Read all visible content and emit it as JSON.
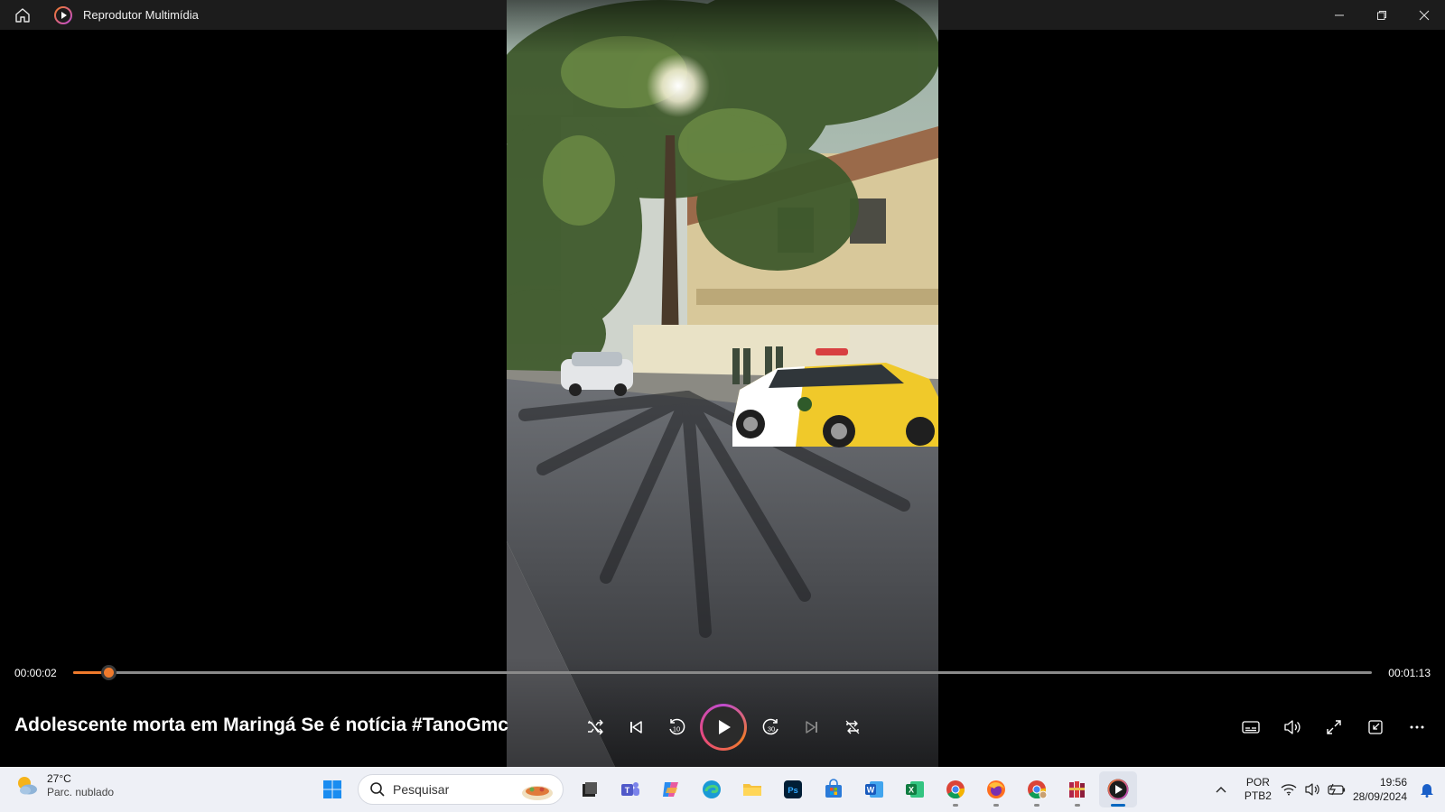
{
  "window": {
    "app_title": "Reprodutor Multimídia",
    "icons": [
      "home-icon",
      "app-logo-icon",
      "minimize-icon",
      "restore-icon",
      "close-icon"
    ]
  },
  "player": {
    "current_time": "00:00:02",
    "total_time": "00:01:13",
    "progress": 0.027,
    "media_title": "Adolescente morta em Maringá Se é notícia #TanoGmc",
    "accent_color": "#f07a2c",
    "controls": [
      "shuffle-icon",
      "previous-icon",
      "rewind-10-icon",
      "play-icon",
      "forward-30-icon",
      "next-icon",
      "repeat-off-icon"
    ],
    "skip_back_label": "10",
    "skip_forward_label": "30",
    "right_controls": [
      "subtitles-icon",
      "volume-icon",
      "fullscreen-icon",
      "mini-player-icon",
      "more-icon"
    ]
  },
  "taskbar": {
    "weather": {
      "temp": "27°C",
      "condition": "Parc. nublado"
    },
    "search_placeholder": "Pesquisar",
    "lang_top": "POR",
    "lang_bottom": "PTB2",
    "time": "19:56",
    "date": "28/09/2024"
  }
}
